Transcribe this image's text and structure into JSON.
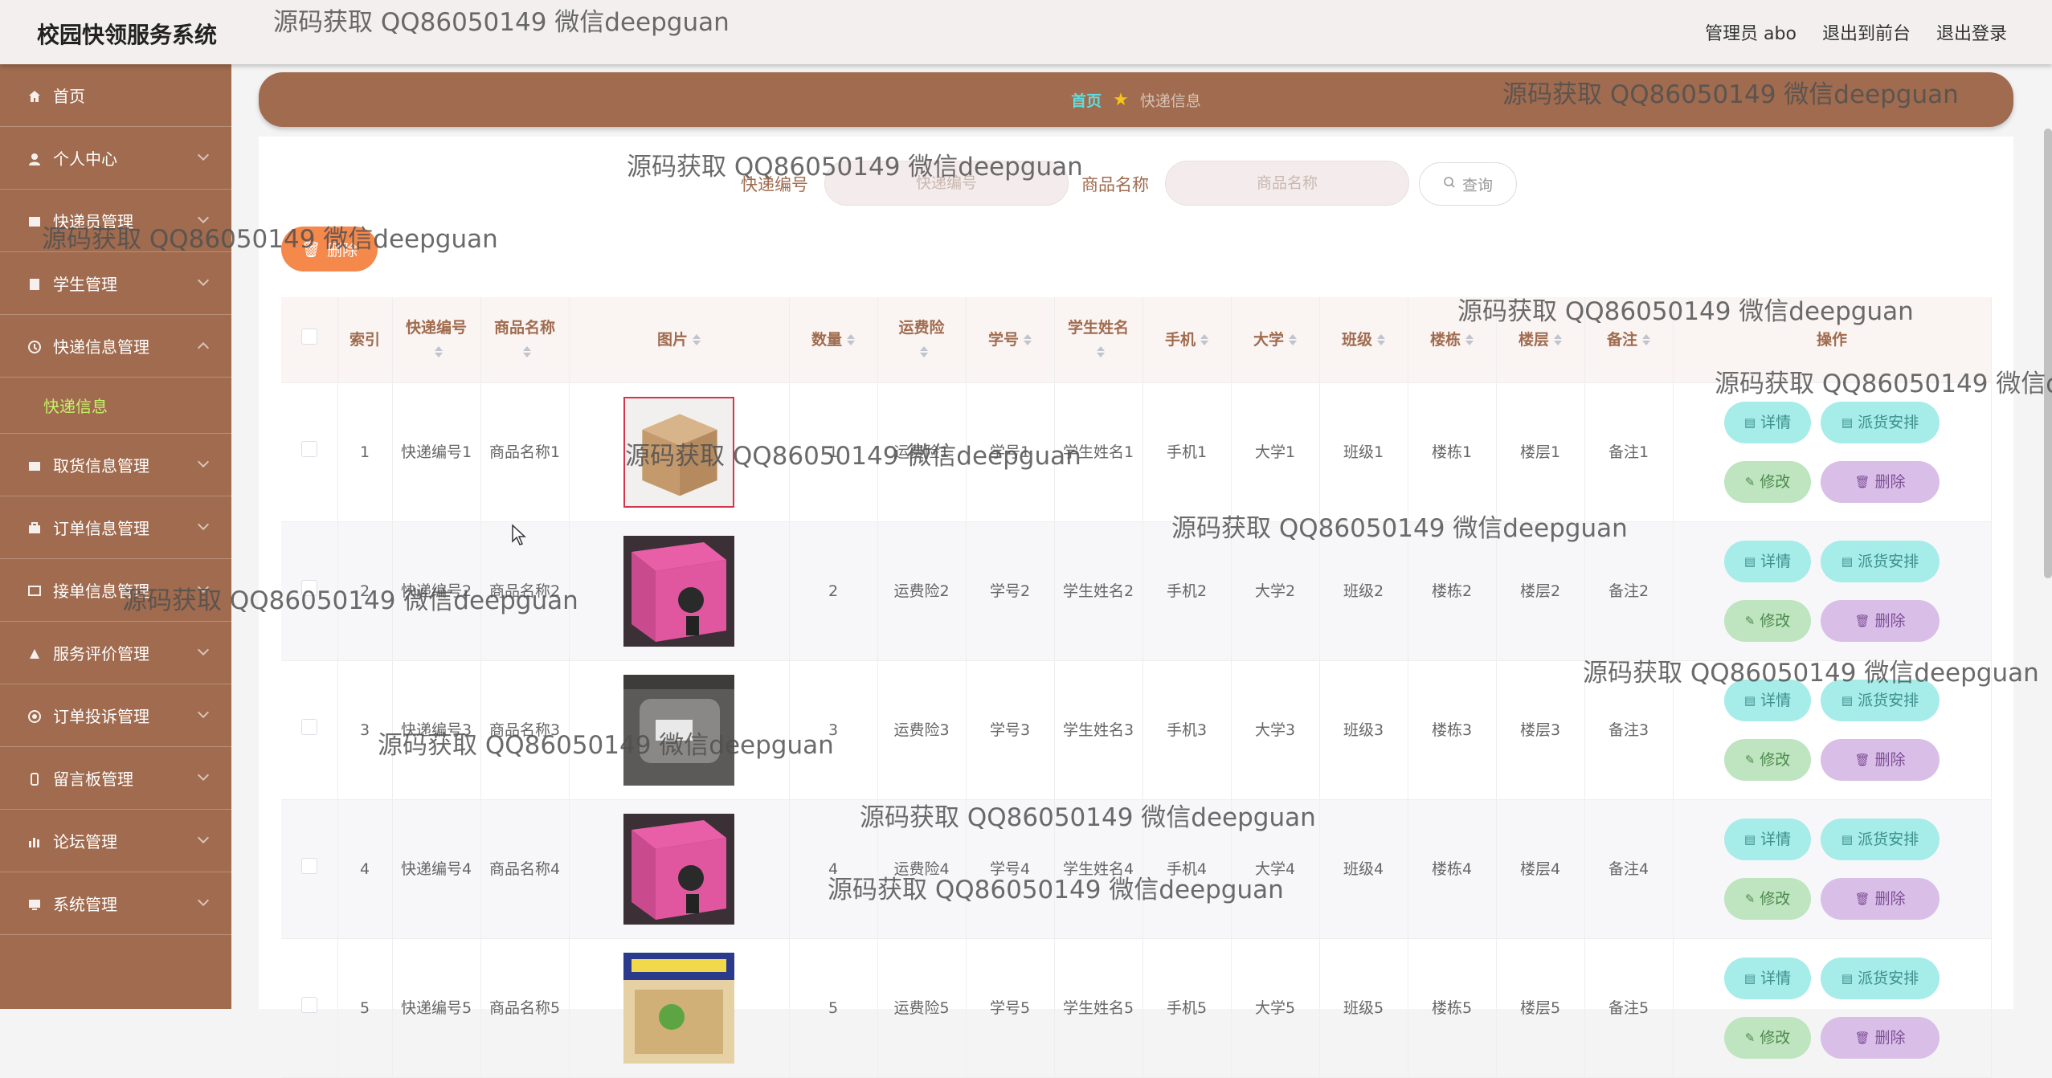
{
  "app": {
    "title": "校园快领服务系统"
  },
  "topnav": {
    "user": "管理员 abo",
    "to_front": "退出到前台",
    "logout": "退出登录"
  },
  "sidebar": {
    "items": [
      {
        "label": "首页",
        "icon": "home-icon"
      },
      {
        "label": "个人中心",
        "icon": "user-icon"
      },
      {
        "label": "快递员管理",
        "icon": "courier-icon"
      },
      {
        "label": "学生管理",
        "icon": "student-icon"
      },
      {
        "label": "快递信息管理",
        "icon": "info-icon"
      },
      {
        "label": "快递信息",
        "icon": ""
      },
      {
        "label": "取货信息管理",
        "icon": "pickup-icon"
      },
      {
        "label": "订单信息管理",
        "icon": "order-icon"
      },
      {
        "label": "接单信息管理",
        "icon": "accept-icon"
      },
      {
        "label": "服务评价管理",
        "icon": "rating-icon"
      },
      {
        "label": "订单投诉管理",
        "icon": "complaint-icon"
      },
      {
        "label": "留言板管理",
        "icon": "message-icon"
      },
      {
        "label": "论坛管理",
        "icon": "forum-icon"
      },
      {
        "label": "系统管理",
        "icon": "system-icon"
      }
    ]
  },
  "breadcrumb": {
    "home": "首页",
    "current": "快递信息"
  },
  "search": {
    "label1": "快递编号",
    "placeholder1": "快递编号",
    "label2": "商品名称",
    "placeholder2": "商品名称",
    "button": "查询"
  },
  "toolbar": {
    "delete": "删除"
  },
  "table": {
    "headers": [
      "索引",
      "快递编号",
      "商品名称",
      "图片",
      "数量",
      "运费险",
      "学号",
      "学生姓名",
      "手机",
      "大学",
      "班级",
      "楼栋",
      "楼层",
      "备注",
      "操作"
    ],
    "rows": [
      {
        "index": "1",
        "code": "快递编号1",
        "name": "商品名称1",
        "qty": "1",
        "ins": "运费险1",
        "sid": "学号1",
        "sname": "学生姓名1",
        "phone": "手机1",
        "uni": "大学1",
        "cls": "班级1",
        "bld": "楼栋1",
        "floor": "楼层1",
        "note": "备注1"
      },
      {
        "index": "2",
        "code": "快递编号2",
        "name": "商品名称2",
        "qty": "2",
        "ins": "运费险2",
        "sid": "学号2",
        "sname": "学生姓名2",
        "phone": "手机2",
        "uni": "大学2",
        "cls": "班级2",
        "bld": "楼栋2",
        "floor": "楼层2",
        "note": "备注2"
      },
      {
        "index": "3",
        "code": "快递编号3",
        "name": "商品名称3",
        "qty": "3",
        "ins": "运费险3",
        "sid": "学号3",
        "sname": "学生姓名3",
        "phone": "手机3",
        "uni": "大学3",
        "cls": "班级3",
        "bld": "楼栋3",
        "floor": "楼层3",
        "note": "备注3"
      },
      {
        "index": "4",
        "code": "快递编号4",
        "name": "商品名称4",
        "qty": "4",
        "ins": "运费险4",
        "sid": "学号4",
        "sname": "学生姓名4",
        "phone": "手机4",
        "uni": "大学4",
        "cls": "班级4",
        "bld": "楼栋4",
        "floor": "楼层4",
        "note": "备注4"
      },
      {
        "index": "5",
        "code": "快递编号5",
        "name": "商品名称5",
        "qty": "5",
        "ins": "运费险5",
        "sid": "学号5",
        "sname": "学生姓名5",
        "phone": "手机5",
        "uni": "大学5",
        "cls": "班级5",
        "bld": "楼栋5",
        "floor": "楼层5",
        "note": "备注5"
      }
    ],
    "actions": {
      "detail": "详情",
      "assign": "派货安排",
      "edit": "修改",
      "delete": "删除"
    }
  },
  "watermark": "源码获取 QQ86050149 微信deepguan",
  "colors": {
    "brand": "#a06b4e",
    "accent_green": "#c6f06b",
    "teal": "#5fdde0",
    "orange": "#f5884b"
  }
}
